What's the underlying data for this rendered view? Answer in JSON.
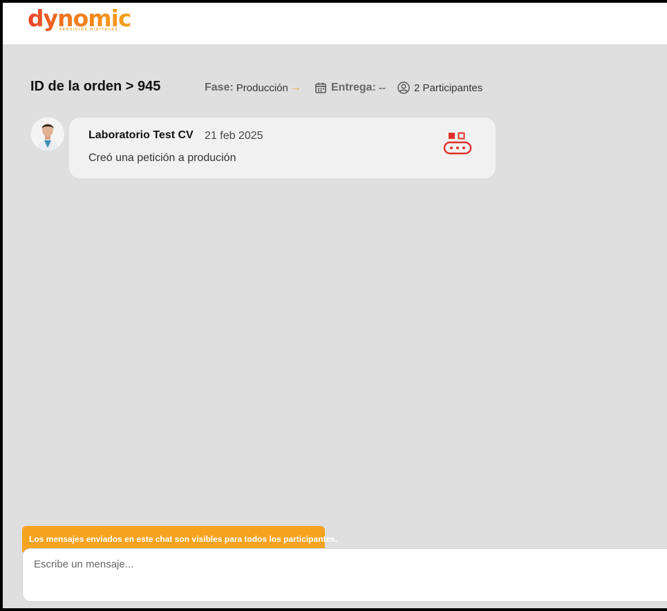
{
  "brand": {
    "name": "dynomic",
    "tagline": "SERVICIOS DIGITALES"
  },
  "order": {
    "title": "ID de la orden > 945",
    "phase_label": "Fase:",
    "phase_value": "Producción",
    "delivery_label": "Entrega:",
    "delivery_value": "--",
    "participants": "2 Participantes"
  },
  "messages": [
    {
      "sender": "Laboratorio Test CV",
      "date": "21 feb 2025",
      "text": "Creó una petición a produción",
      "icon": "conveyor-icon"
    }
  ],
  "chat": {
    "notice": "Los mensajes enviados en este chat son visibles para todos los participantes.",
    "placeholder": "Escribe un mensaje..."
  },
  "colors": {
    "accent": "#f5a31f",
    "alert": "#e0312b",
    "background": "#dfdfdf"
  }
}
